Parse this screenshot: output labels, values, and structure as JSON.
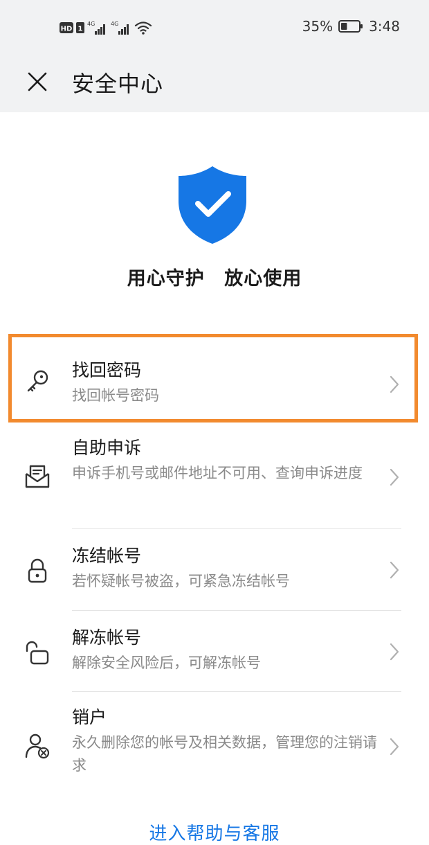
{
  "status_bar": {
    "hd_label": "HD",
    "sim1_label": "1",
    "net1": "4G",
    "net2": "4G",
    "battery_percent": "35%",
    "battery_level": 0.35,
    "time": "3:48"
  },
  "header": {
    "title": "安全中心"
  },
  "hero": {
    "slogan": "用心守护 放心使用"
  },
  "menu": {
    "items": [
      {
        "title": "找回密码",
        "subtitle": "找回帐号密码",
        "icon": "key-icon"
      },
      {
        "title": "自助申诉",
        "subtitle": "申诉手机号或邮件地址不可用、查询申诉进度",
        "icon": "appeal-mail-icon"
      },
      {
        "title": "冻结帐号",
        "subtitle": "若怀疑帐号被盗，可紧急冻结帐号",
        "icon": "lock-icon"
      },
      {
        "title": "解冻帐号",
        "subtitle": "解除安全风险后，可解冻帐号",
        "icon": "unlock-icon"
      },
      {
        "title": "销户",
        "subtitle": "永久删除您的帐号及相关数据，管理您的注销请求",
        "icon": "user-remove-icon"
      }
    ]
  },
  "footer": {
    "help_link": "进入帮助与客服"
  },
  "colors": {
    "accent": "#1677e5",
    "highlight": "#f28a2e",
    "header_bg": "#f1f2f3"
  }
}
